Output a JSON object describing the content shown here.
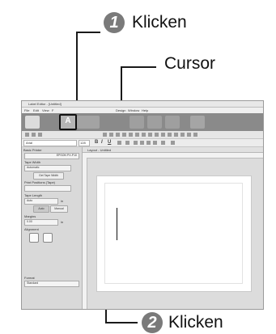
{
  "callouts": {
    "step1": {
      "number": "1",
      "label": "Klicken"
    },
    "cursor": {
      "label": "Cursor"
    },
    "step2": {
      "number": "2",
      "label": "Klicken"
    }
  },
  "app": {
    "window_title": "Label Editor - [Untitled]",
    "menu": [
      "File",
      "Edit",
      "View",
      "F",
      "Design",
      "Window",
      "Help"
    ],
    "ribbon": {
      "new_open_label": "New/Open",
      "text_label": "Text"
    },
    "toolbar": {
      "font": "Arial",
      "size": "128",
      "bold": "B",
      "italic": "I",
      "underline": "U"
    },
    "sidebar": {
      "header": "Basic Printer",
      "printer": "EPSON PX-P10",
      "tape_width_label": "Tape Width",
      "tape_width_value": "Automatic",
      "get_tape_width": "Get Tape Width",
      "print_positions_label": "Print Positions (Tape)",
      "tape_length_label": "Tape Length",
      "tape_length_value": "Auto",
      "tape_length_unit": "in",
      "auto_button": "Auto",
      "manual_button": "Manual",
      "margins_label": "Margins",
      "margins_value": "0.00",
      "margins_unit": "in",
      "alignment_label": "Alignment",
      "format_label": "Format",
      "format_value": "Standard"
    },
    "tab": "Layout - Untitled"
  },
  "colors": {
    "badge": "#7a7a7a",
    "ribbon": "#8a8a8a",
    "callout_line": "#1a1a1a"
  }
}
